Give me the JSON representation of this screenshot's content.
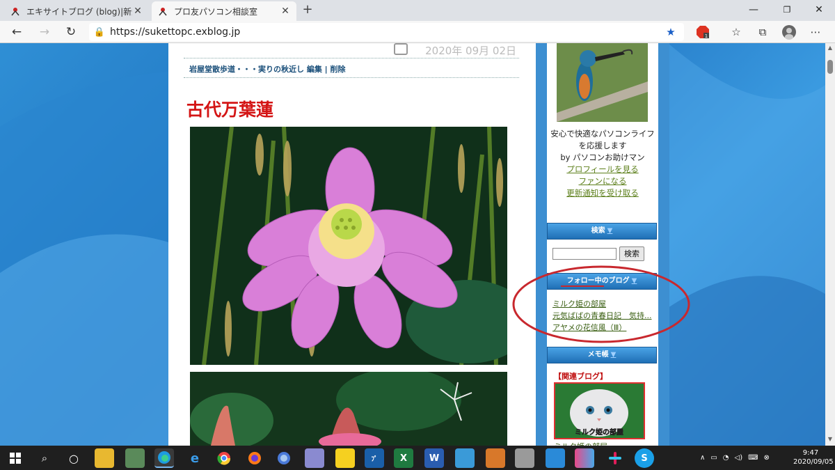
{
  "browser": {
    "tabs": [
      {
        "title": "エキサイトブログ (blog)|新規投稿",
        "active": false
      },
      {
        "title": "プロ友パソコン相談室",
        "active": true
      }
    ],
    "url": "https://sukettopc.exblog.jp"
  },
  "blog": {
    "date": "2020年 09月 02日",
    "post_meta": "岩屋堂散歩道・・・実りの秋近し 編集 | 削除",
    "post_title": "古代万葉蓮"
  },
  "sidebar": {
    "intro_lines": [
      "安心で快適なパソコンライフ",
      "を応援します",
      "by パソコンお助けマン"
    ],
    "profile_links": [
      "プロフィールを見る",
      "ファンになる",
      "更新通知を受け取る"
    ],
    "search_heading": "検索",
    "search_button": "検索",
    "follow_heading": "フォロー中のブログ",
    "follow_items": [
      "ミルク姫の部屋",
      "元気ばばの青春日記　気持...",
      "アヤメの花信風（Ⅲ）"
    ],
    "memo_heading": "メモ帳",
    "memo_label": "【関連ブログ】",
    "banner_text": "ミルク姫の部屋",
    "memo_next": "ミルク姫の部屋"
  },
  "taskbar": {
    "time": "9:47",
    "date": "2020/09/05"
  },
  "colors": {
    "title_red": "#d41515",
    "link_green": "#5c7f1a",
    "annotation_red": "#c8282e",
    "sidebar_blue": "#3d8fd1"
  }
}
